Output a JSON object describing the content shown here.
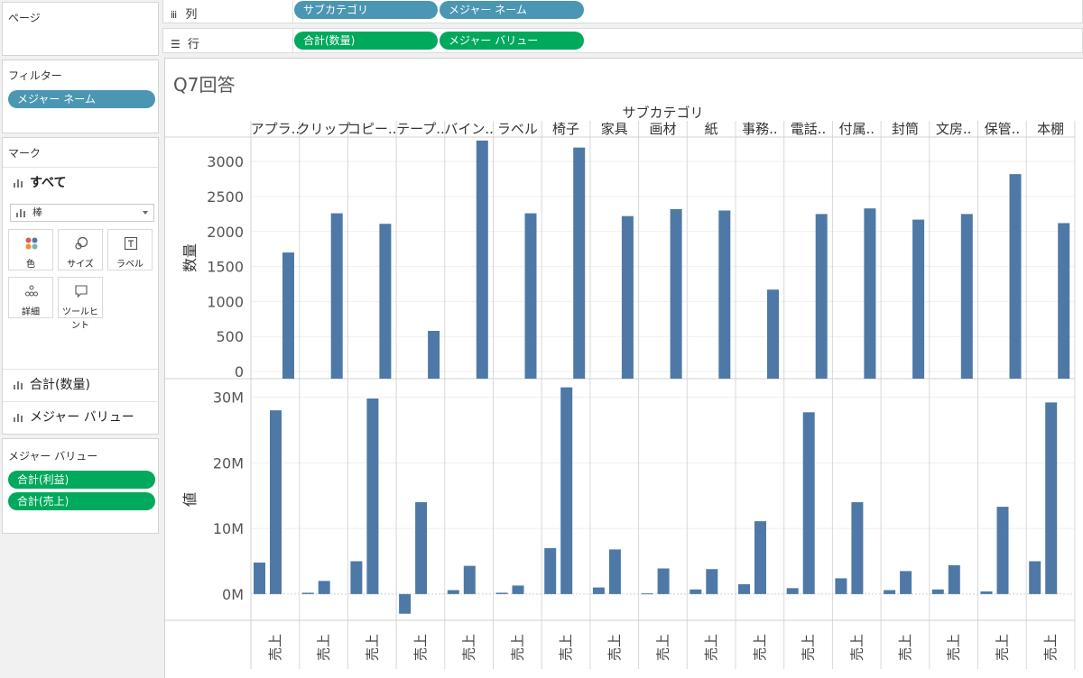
{
  "pages": {
    "title": "ページ"
  },
  "filters": {
    "title": "フィルター",
    "pills": [
      "メジャー ネーム"
    ]
  },
  "marks": {
    "title": "マーク",
    "all_label": "すべて",
    "mark_type": "棒",
    "buttons": [
      "色",
      "サイズ",
      "ラベル",
      "詳細",
      "ツールヒント"
    ],
    "rows": [
      "合計(数量)",
      "メジャー バリュー"
    ]
  },
  "measure_values": {
    "title": "メジャー バリュー",
    "pills": [
      "合計(利益)",
      "合計(売上)"
    ]
  },
  "columns_shelf": {
    "title": "列",
    "pills": [
      "サブカテゴリ",
      "メジャー ネーム"
    ]
  },
  "rows_shelf": {
    "title": "行",
    "pills": [
      "合計(数量)",
      "メジャー バリュー"
    ]
  },
  "sheet_title": "Q7回答",
  "colors": {
    "bar": "#4e79a7",
    "dimension_pill": "#4a96b3",
    "measure_pill": "#00a95c"
  },
  "chart_data": {
    "type": "bar",
    "header_title": "サブカテゴリ",
    "categories": [
      "アプラ..",
      "クリップ",
      "コピー..",
      "テープ..",
      "バイン..",
      "ラベル",
      "椅子",
      "家具",
      "画材",
      "紙",
      "事務..",
      "電話..",
      "付属..",
      "封筒",
      "文房..",
      "保管..",
      "本棚"
    ],
    "column_label": "売上",
    "top_panel": {
      "ylabel": "数量",
      "ylim": [
        0,
        3350
      ],
      "ticks": [
        0,
        500,
        1000,
        1500,
        2000,
        2500,
        3000
      ],
      "values": [
        1700,
        2260,
        2110,
        580,
        3300,
        2260,
        3200,
        2220,
        2320,
        2300,
        1170,
        2250,
        2330,
        2170,
        2250,
        2820,
        2120
      ]
    },
    "bottom_panel": {
      "ylabel": "値",
      "ylim": [
        -4000000,
        32000000
      ],
      "ticks": [
        0,
        10000000,
        20000000,
        30000000
      ],
      "tick_labels": [
        "0M",
        "10M",
        "20M",
        "30M"
      ],
      "series": [
        {
          "values": [
            4800000,
            200000,
            5000000,
            -3000000,
            600000,
            200000,
            7000000,
            1000000,
            100000,
            700000,
            1500000,
            900000,
            2400000,
            600000,
            700000,
            400000,
            5000000
          ]
        },
        {
          "values": [
            28000000,
            2000000,
            29800000,
            14000000,
            4300000,
            1300000,
            31500000,
            6800000,
            3900000,
            3800000,
            11100000,
            27700000,
            14000000,
            3500000,
            4400000,
            13300000,
            29200000
          ]
        }
      ]
    }
  }
}
